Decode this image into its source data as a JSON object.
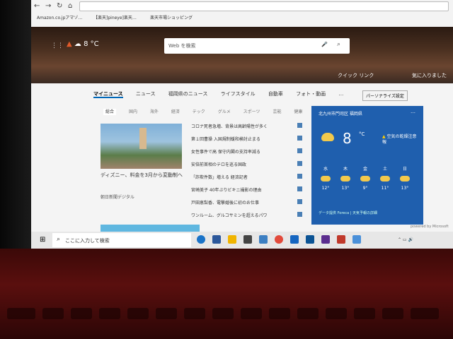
{
  "browser": {
    "favorites": [
      "Amazon.co.jpアマゾ…",
      "【楽天]pineye]楽天…",
      "楽天市場ショッピング"
    ]
  },
  "hero": {
    "weather_text": "8 °C",
    "search_placeholder": "Web を検索",
    "quick_links_label": "クイック リンク",
    "favorites_label": "気に入りました"
  },
  "topnav": {
    "tabs": [
      "マイニュース",
      "ニュース",
      "福岡県のニュース",
      "ライフスタイル",
      "自動車",
      "フォト・動画",
      "…"
    ],
    "active": 0,
    "personalize_label": "パーソナライズ設定"
  },
  "subnav": {
    "tabs": [
      "総合",
      "国内",
      "海外",
      "経済",
      "テック",
      "グルメ",
      "スポーツ",
      "芸能",
      "健康"
    ],
    "active": 0
  },
  "feature": {
    "caption": "ディズニー、料金を3月から変動制へ",
    "source": "朝日新聞デジタル"
  },
  "headlines": [
    "コロナ死者急増、背景は高齢陽性が多く",
    "第１回曹操 入国規制緩和検討止まる",
    "女性事件で高 保守内閣の支持率減る",
    "安倍前首相のテロを巡る国政",
    "「詐欺件数」増える 経済記者",
    "宮崎美子 40年ぶりビキニ撮影の理由",
    "戸田恵梨香、電撃婚後に初のお仕事",
    "ワンルーム、グルコサミンを超えるパワ"
  ],
  "weather_card": {
    "location": "北九州市門司区 福岡県",
    "temp": "8",
    "unit": "°C",
    "alert": "空気の乾燥注意報",
    "days": [
      {
        "label": "水",
        "temp": "12°"
      },
      {
        "label": "木",
        "temp": "13°"
      },
      {
        "label": "金",
        "temp": "9°"
      },
      {
        "label": "土",
        "temp": "11°"
      },
      {
        "label": "日",
        "temp": "13°"
      }
    ],
    "footer": "データ提供 Foreca | 天気予報の詳細"
  },
  "powered_label": "powered by Microsoft",
  "taskbar": {
    "search_placeholder": "ここに入力して検索"
  }
}
